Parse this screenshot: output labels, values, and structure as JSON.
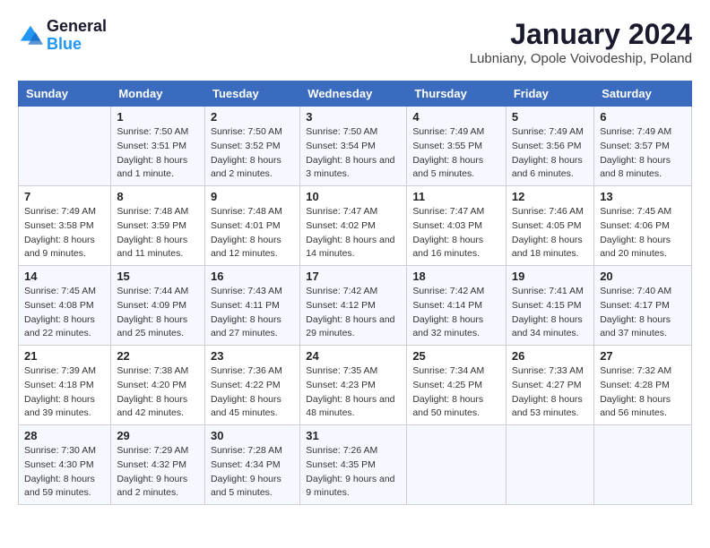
{
  "header": {
    "logo_line1": "General",
    "logo_line2": "Blue",
    "title": "January 2024",
    "subtitle": "Lubniany, Opole Voivodeship, Poland"
  },
  "days_of_week": [
    "Sunday",
    "Monday",
    "Tuesday",
    "Wednesday",
    "Thursday",
    "Friday",
    "Saturday"
  ],
  "weeks": [
    [
      {
        "day": "",
        "sunrise": "",
        "sunset": "",
        "daylight": ""
      },
      {
        "day": "1",
        "sunrise": "Sunrise: 7:50 AM",
        "sunset": "Sunset: 3:51 PM",
        "daylight": "Daylight: 8 hours and 1 minute."
      },
      {
        "day": "2",
        "sunrise": "Sunrise: 7:50 AM",
        "sunset": "Sunset: 3:52 PM",
        "daylight": "Daylight: 8 hours and 2 minutes."
      },
      {
        "day": "3",
        "sunrise": "Sunrise: 7:50 AM",
        "sunset": "Sunset: 3:54 PM",
        "daylight": "Daylight: 8 hours and 3 minutes."
      },
      {
        "day": "4",
        "sunrise": "Sunrise: 7:49 AM",
        "sunset": "Sunset: 3:55 PM",
        "daylight": "Daylight: 8 hours and 5 minutes."
      },
      {
        "day": "5",
        "sunrise": "Sunrise: 7:49 AM",
        "sunset": "Sunset: 3:56 PM",
        "daylight": "Daylight: 8 hours and 6 minutes."
      },
      {
        "day": "6",
        "sunrise": "Sunrise: 7:49 AM",
        "sunset": "Sunset: 3:57 PM",
        "daylight": "Daylight: 8 hours and 8 minutes."
      }
    ],
    [
      {
        "day": "7",
        "sunrise": "Sunrise: 7:49 AM",
        "sunset": "Sunset: 3:58 PM",
        "daylight": "Daylight: 8 hours and 9 minutes."
      },
      {
        "day": "8",
        "sunrise": "Sunrise: 7:48 AM",
        "sunset": "Sunset: 3:59 PM",
        "daylight": "Daylight: 8 hours and 11 minutes."
      },
      {
        "day": "9",
        "sunrise": "Sunrise: 7:48 AM",
        "sunset": "Sunset: 4:01 PM",
        "daylight": "Daylight: 8 hours and 12 minutes."
      },
      {
        "day": "10",
        "sunrise": "Sunrise: 7:47 AM",
        "sunset": "Sunset: 4:02 PM",
        "daylight": "Daylight: 8 hours and 14 minutes."
      },
      {
        "day": "11",
        "sunrise": "Sunrise: 7:47 AM",
        "sunset": "Sunset: 4:03 PM",
        "daylight": "Daylight: 8 hours and 16 minutes."
      },
      {
        "day": "12",
        "sunrise": "Sunrise: 7:46 AM",
        "sunset": "Sunset: 4:05 PM",
        "daylight": "Daylight: 8 hours and 18 minutes."
      },
      {
        "day": "13",
        "sunrise": "Sunrise: 7:45 AM",
        "sunset": "Sunset: 4:06 PM",
        "daylight": "Daylight: 8 hours and 20 minutes."
      }
    ],
    [
      {
        "day": "14",
        "sunrise": "Sunrise: 7:45 AM",
        "sunset": "Sunset: 4:08 PM",
        "daylight": "Daylight: 8 hours and 22 minutes."
      },
      {
        "day": "15",
        "sunrise": "Sunrise: 7:44 AM",
        "sunset": "Sunset: 4:09 PM",
        "daylight": "Daylight: 8 hours and 25 minutes."
      },
      {
        "day": "16",
        "sunrise": "Sunrise: 7:43 AM",
        "sunset": "Sunset: 4:11 PM",
        "daylight": "Daylight: 8 hours and 27 minutes."
      },
      {
        "day": "17",
        "sunrise": "Sunrise: 7:42 AM",
        "sunset": "Sunset: 4:12 PM",
        "daylight": "Daylight: 8 hours and 29 minutes."
      },
      {
        "day": "18",
        "sunrise": "Sunrise: 7:42 AM",
        "sunset": "Sunset: 4:14 PM",
        "daylight": "Daylight: 8 hours and 32 minutes."
      },
      {
        "day": "19",
        "sunrise": "Sunrise: 7:41 AM",
        "sunset": "Sunset: 4:15 PM",
        "daylight": "Daylight: 8 hours and 34 minutes."
      },
      {
        "day": "20",
        "sunrise": "Sunrise: 7:40 AM",
        "sunset": "Sunset: 4:17 PM",
        "daylight": "Daylight: 8 hours and 37 minutes."
      }
    ],
    [
      {
        "day": "21",
        "sunrise": "Sunrise: 7:39 AM",
        "sunset": "Sunset: 4:18 PM",
        "daylight": "Daylight: 8 hours and 39 minutes."
      },
      {
        "day": "22",
        "sunrise": "Sunrise: 7:38 AM",
        "sunset": "Sunset: 4:20 PM",
        "daylight": "Daylight: 8 hours and 42 minutes."
      },
      {
        "day": "23",
        "sunrise": "Sunrise: 7:36 AM",
        "sunset": "Sunset: 4:22 PM",
        "daylight": "Daylight: 8 hours and 45 minutes."
      },
      {
        "day": "24",
        "sunrise": "Sunrise: 7:35 AM",
        "sunset": "Sunset: 4:23 PM",
        "daylight": "Daylight: 8 hours and 48 minutes."
      },
      {
        "day": "25",
        "sunrise": "Sunrise: 7:34 AM",
        "sunset": "Sunset: 4:25 PM",
        "daylight": "Daylight: 8 hours and 50 minutes."
      },
      {
        "day": "26",
        "sunrise": "Sunrise: 7:33 AM",
        "sunset": "Sunset: 4:27 PM",
        "daylight": "Daylight: 8 hours and 53 minutes."
      },
      {
        "day": "27",
        "sunrise": "Sunrise: 7:32 AM",
        "sunset": "Sunset: 4:28 PM",
        "daylight": "Daylight: 8 hours and 56 minutes."
      }
    ],
    [
      {
        "day": "28",
        "sunrise": "Sunrise: 7:30 AM",
        "sunset": "Sunset: 4:30 PM",
        "daylight": "Daylight: 8 hours and 59 minutes."
      },
      {
        "day": "29",
        "sunrise": "Sunrise: 7:29 AM",
        "sunset": "Sunset: 4:32 PM",
        "daylight": "Daylight: 9 hours and 2 minutes."
      },
      {
        "day": "30",
        "sunrise": "Sunrise: 7:28 AM",
        "sunset": "Sunset: 4:34 PM",
        "daylight": "Daylight: 9 hours and 5 minutes."
      },
      {
        "day": "31",
        "sunrise": "Sunrise: 7:26 AM",
        "sunset": "Sunset: 4:35 PM",
        "daylight": "Daylight: 9 hours and 9 minutes."
      },
      {
        "day": "",
        "sunrise": "",
        "sunset": "",
        "daylight": ""
      },
      {
        "day": "",
        "sunrise": "",
        "sunset": "",
        "daylight": ""
      },
      {
        "day": "",
        "sunrise": "",
        "sunset": "",
        "daylight": ""
      }
    ]
  ]
}
